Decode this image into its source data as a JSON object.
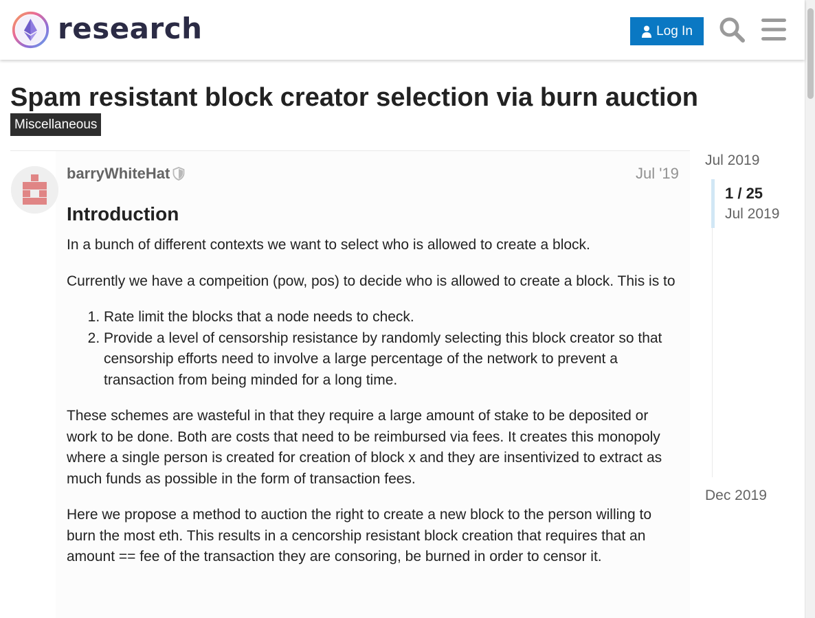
{
  "header": {
    "site_name": "research",
    "login_label": "Log In",
    "logo_icon": "ethereum-research-logo-icon",
    "login_icon": "user-icon",
    "search_icon": "search-icon",
    "menu_icon": "hamburger-menu-icon"
  },
  "topic": {
    "title": "Spam resistant block creator selection via burn auction",
    "category": "Miscellaneous"
  },
  "post": {
    "username": "barryWhiteHat",
    "moderator_icon": "shield-icon",
    "date": "Jul '19",
    "heading": "Introduction",
    "p1": "In a bunch of different contexts we want to select who is allowed to create a block.",
    "p2": "Currently we have a compeition (pow, pos) to decide who is allowed to create a block. This is to",
    "list": [
      "Rate limit the blocks that a node needs to check.",
      "Provide a level of censorship resistance by randomly selecting this block creator so that censorship efforts need to involve a large percentage of the network to prevent a transaction from being minded for a long time."
    ],
    "p3": "These schemes are wasteful in that they require a large amount of stake to be deposited or work to be done. Both are costs that need to be reimbursed via fees. It creates this monopoly where a single person is created for creation of block x and they are insentivized to extract as much funds as possible in the form of transaction fees.",
    "p4": "Here we propose a method to auction the right to create a new block to the person willing to burn the most eth. This results in a cencorship resistant block creation that requires that an amount == fee of the transaction they are consoring, be burned in order to censor it."
  },
  "timeline": {
    "start_date": "Jul 2019",
    "position": "1 / 25",
    "current_date": "Jul 2019",
    "end_date": "Dec 2019"
  },
  "colors": {
    "primary_button": "#0a78c3",
    "category_badge": "#2e2e2e",
    "timeline_handle": "#d1e7f5"
  }
}
